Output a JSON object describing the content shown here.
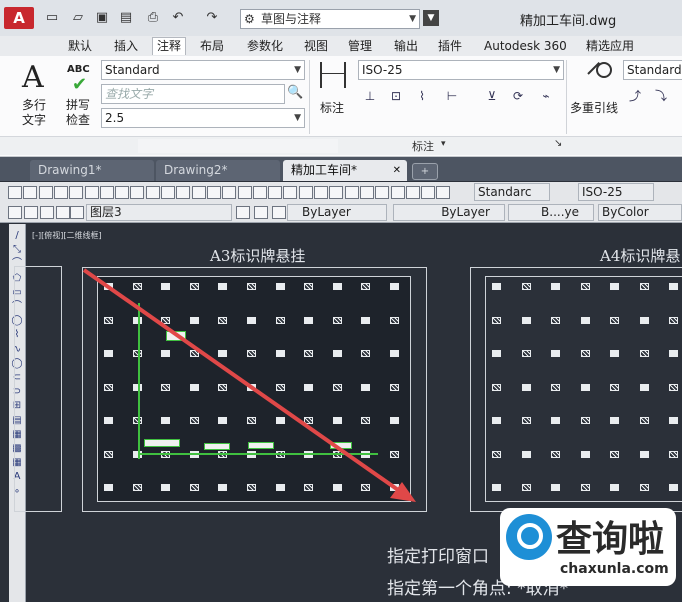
{
  "titlebar": {
    "app_letter": "A",
    "workspace": "草图与注释",
    "doc_title": "精加工车间.dwg"
  },
  "ribbon_tabs": [
    "默认",
    "插入",
    "注释",
    "布局",
    "参数化",
    "视图",
    "管理",
    "输出",
    "插件",
    "Autodesk 360",
    "精选应用"
  ],
  "ribbon_active_tab": "注释",
  "ribbon": {
    "multiline_text_label": "多行文字",
    "abc_label": "ABC",
    "spellcheck_label": "拼写检查",
    "text_style": "Standard",
    "find_text_placeholder": "查找文字",
    "text_height": "2.5",
    "dimension_label": "标注",
    "dim_style": "ISO-25",
    "multileader_label": "多重引线",
    "mleader_style": "Standard",
    "panel_title": "标注"
  },
  "doc_tabs": [
    "Drawing1*",
    "Drawing2*",
    "精加工车间*"
  ],
  "doc_active_tab": "精加工车间*",
  "toolbar1": {
    "text_style": "Standarc",
    "dim_style": "ISO-25"
  },
  "toolbar2": {
    "layer": "图层3",
    "color": "ByLayer",
    "linetype": "ByLayer",
    "lineweight": "B....ye",
    "plotstyle": "ByColor"
  },
  "viewport_label": "[-][俯视][二维线框]",
  "sheet_a3_title": "A3标识牌悬挂",
  "sheet_a4_title": "A4标识牌悬",
  "command_lines": [
    "指定打印窗口",
    "指定第一个角点: *取消*"
  ],
  "watermark": {
    "text": "查询啦",
    "url": "chaxunla.com"
  },
  "colors": {
    "model_bg": "#2b3039",
    "accent_green": "#40c040",
    "arrow_red": "#e04848",
    "ribbon_bg": "#fbfbfc"
  }
}
